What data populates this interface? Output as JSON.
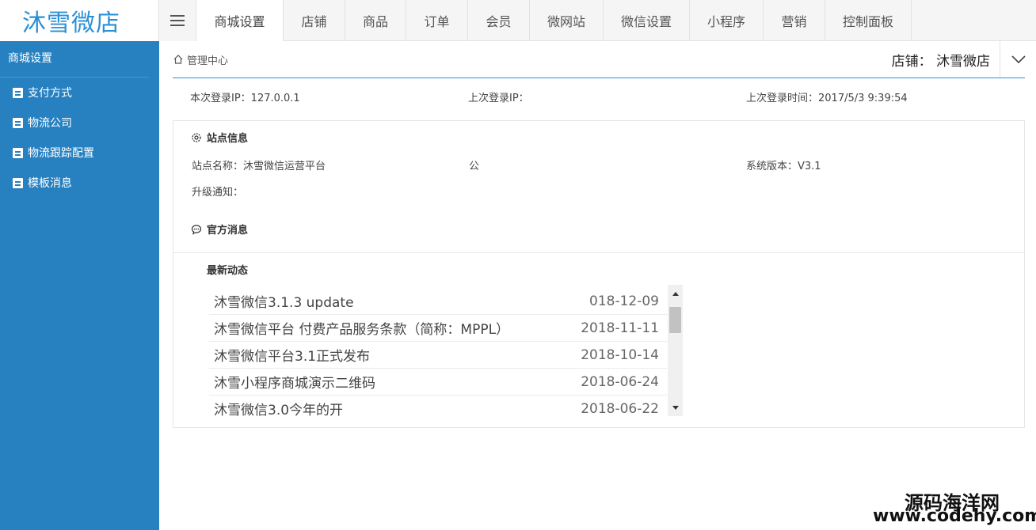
{
  "logo": {
    "text": "沐雪微店",
    "color": "#2a90d6"
  },
  "nav": {
    "tabs": [
      {
        "label": "商城设置",
        "active": true
      },
      {
        "label": "店铺",
        "active": false
      },
      {
        "label": "商品",
        "active": false
      },
      {
        "label": "订单",
        "active": false
      },
      {
        "label": "会员",
        "active": false
      },
      {
        "label": "微网站",
        "active": false
      },
      {
        "label": "微信设置",
        "active": false
      },
      {
        "label": "小程序",
        "active": false
      },
      {
        "label": "营销",
        "active": false
      },
      {
        "label": "控制面板",
        "active": false
      }
    ]
  },
  "sidebar": {
    "title": "商城设置",
    "color": "#2780c0",
    "items": [
      {
        "label": "支付方式",
        "icon": "document-icon"
      },
      {
        "label": "物流公司",
        "icon": "document-icon"
      },
      {
        "label": "物流跟踪配置",
        "icon": "document-icon"
      },
      {
        "label": "模板消息",
        "icon": "document-icon"
      }
    ]
  },
  "header": {
    "breadcrumb": "管理中心",
    "store": "店铺： 沐雪微店"
  },
  "login": {
    "current_ip": "本次登录IP：127.0.0.1",
    "last_ip": "上次登录IP：",
    "last_time": "上次登录时间：2017/5/3 9:39:54"
  },
  "site_info": {
    "title": "站点信息",
    "site_name": "站点名称：沐雪微信运营平台",
    "company": "公",
    "version": "系统版本：V3.1",
    "upgrade": "升级通知："
  },
  "official": {
    "title": "官方消息",
    "news_title": "最新动态",
    "items": [
      {
        "title": "沐雪微信3.1.3 update",
        "date": "018-12-09"
      },
      {
        "title": "沐雪微信平台 付费产品服务条款（简称：MPPL）",
        "date": "2018-11-11"
      },
      {
        "title": "沐雪微信平台3.1正式发布",
        "date": "2018-10-14"
      },
      {
        "title": "沐雪小程序商城演示二维码",
        "date": "2018-06-24"
      },
      {
        "title": "沐雪微信3.0今年的开",
        "date": "2018-06-22"
      }
    ]
  },
  "watermark": {
    "name": "源码海洋网",
    "url": "www.codehy.com"
  }
}
